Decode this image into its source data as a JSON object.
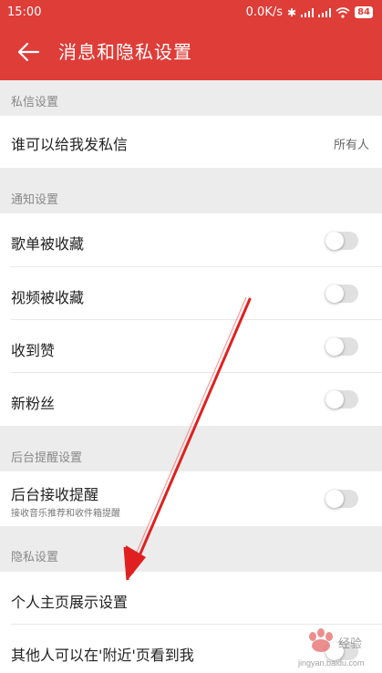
{
  "status_bar": {
    "time": "15:00",
    "network_speed": "0.0K/s",
    "battery": "84"
  },
  "header": {
    "title": "消息和隐私设置",
    "back_icon": "back-arrow-icon"
  },
  "sections": {
    "private_message": {
      "label": "私信设置",
      "who_can_message": "谁可以给我发私信",
      "who_can_message_value": "所有人"
    },
    "notifications": {
      "label": "通知设置",
      "playlist_collected": "歌单被收藏",
      "video_collected": "视频被收藏",
      "received_like": "收到赞",
      "new_fans": "新粉丝"
    },
    "background": {
      "label": "后台提醒设置",
      "receive_reminder": "后台接收提醒",
      "receive_reminder_sub": "接收音乐推荐和收件箱提醒"
    },
    "privacy": {
      "label": "隐私设置",
      "homepage_display": "个人主页展示设置",
      "nearby_visible": "其他人可以在'附近'页看到我"
    }
  },
  "toggles": {
    "playlist_collected": false,
    "video_collected": false,
    "received_like": false,
    "new_fans": false,
    "receive_reminder": false,
    "nearby_visible": false
  },
  "colors": {
    "header": "#df3d38",
    "annotation_arrow": "#e02020"
  },
  "watermark": {
    "logo": "baidu-jingyan-logo",
    "line1": "Bai度经验",
    "url": "jingyan.baidu.com"
  }
}
